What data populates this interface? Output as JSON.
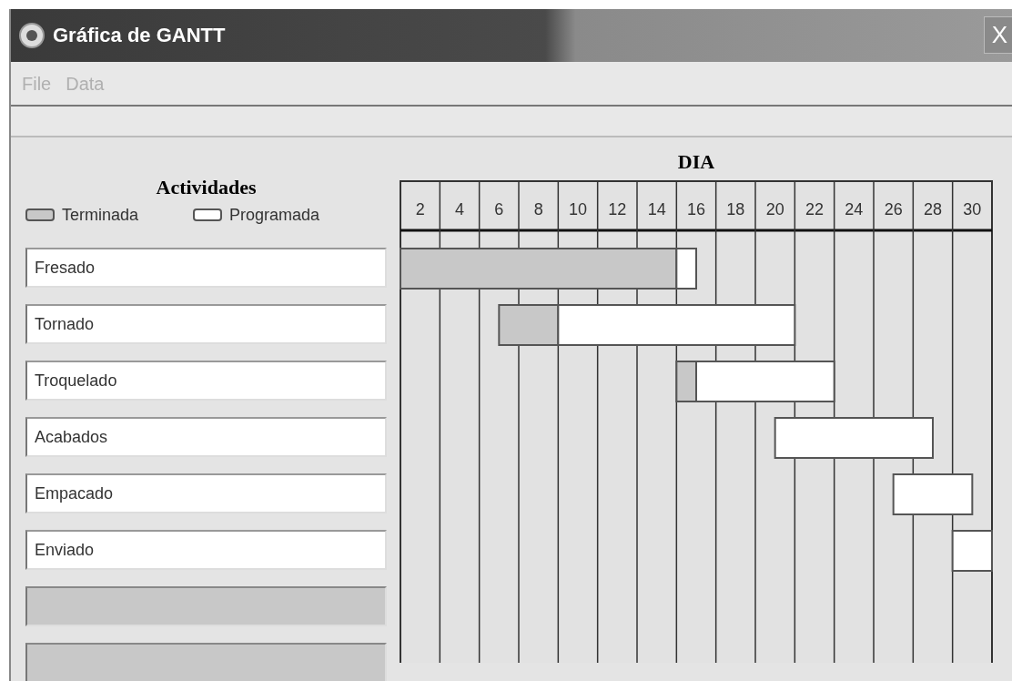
{
  "window": {
    "title": "Gráfica de GANTT",
    "close": "X"
  },
  "menu": [
    {
      "label": "File",
      "disabled": true
    },
    {
      "label": "Data",
      "disabled": true
    }
  ],
  "activities_panel": {
    "title": "Actividades"
  },
  "legend": [
    {
      "kind": "done",
      "label": "Terminada"
    },
    {
      "kind": "plan",
      "label": "Programada"
    }
  ],
  "timeline": {
    "title": "DIA",
    "days": [
      "2",
      "4",
      "6",
      "8",
      "10",
      "12",
      "14",
      "16",
      "18",
      "20",
      "22",
      "24",
      "26",
      "28",
      "30"
    ]
  },
  "activities": [
    {
      "kind": "named",
      "name": "Fresado",
      "day_slots": [
        {
          "kind": "done"
        },
        {
          "kind": "done"
        },
        {
          "kind": "done"
        },
        {
          "kind": "done"
        },
        {
          "kind": "done"
        },
        {
          "kind": "done"
        },
        {
          "kind": "done"
        },
        {
          "kind": "done"
        },
        {
          "kind": "done"
        },
        {
          "kind": "done"
        },
        {
          "kind": "done"
        },
        {
          "kind": "done"
        },
        {
          "kind": "done"
        },
        {
          "kind": "done"
        },
        {
          "kind": "plan"
        }
      ]
    },
    {
      "kind": "named",
      "name": "Tornado",
      "day_slots": [
        {
          "kind": "none"
        },
        {
          "kind": "none"
        },
        {
          "kind": "none"
        },
        {
          "kind": "none"
        },
        {
          "kind": "none"
        },
        {
          "kind": "done"
        },
        {
          "kind": "done"
        },
        {
          "kind": "done"
        },
        {
          "kind": "plan"
        },
        {
          "kind": "plan"
        },
        {
          "kind": "plan"
        },
        {
          "kind": "plan"
        },
        {
          "kind": "plan"
        },
        {
          "kind": "plan"
        },
        {
          "kind": "plan"
        },
        {
          "kind": "plan"
        },
        {
          "kind": "plan"
        },
        {
          "kind": "plan"
        },
        {
          "kind": "plan"
        },
        {
          "kind": "plan"
        }
      ]
    },
    {
      "kind": "named",
      "name": "Troquelado",
      "day_slots": [
        {
          "kind": "none"
        },
        {
          "kind": "none"
        },
        {
          "kind": "none"
        },
        {
          "kind": "none"
        },
        {
          "kind": "none"
        },
        {
          "kind": "none"
        },
        {
          "kind": "none"
        },
        {
          "kind": "none"
        },
        {
          "kind": "none"
        },
        {
          "kind": "none"
        },
        {
          "kind": "none"
        },
        {
          "kind": "none"
        },
        {
          "kind": "none"
        },
        {
          "kind": "none"
        },
        {
          "kind": "done"
        },
        {
          "kind": "plan"
        },
        {
          "kind": "plan"
        },
        {
          "kind": "plan"
        },
        {
          "kind": "plan"
        },
        {
          "kind": "plan"
        },
        {
          "kind": "plan"
        },
        {
          "kind": "plan"
        }
      ]
    },
    {
      "kind": "named",
      "name": "Acabados",
      "day_slots": [
        {
          "kind": "none"
        },
        {
          "kind": "none"
        },
        {
          "kind": "none"
        },
        {
          "kind": "none"
        },
        {
          "kind": "none"
        },
        {
          "kind": "none"
        },
        {
          "kind": "none"
        },
        {
          "kind": "none"
        },
        {
          "kind": "none"
        },
        {
          "kind": "none"
        },
        {
          "kind": "none"
        },
        {
          "kind": "none"
        },
        {
          "kind": "none"
        },
        {
          "kind": "none"
        },
        {
          "kind": "none"
        },
        {
          "kind": "none"
        },
        {
          "kind": "none"
        },
        {
          "kind": "none"
        },
        {
          "kind": "none"
        },
        {
          "kind": "plan"
        },
        {
          "kind": "plan"
        },
        {
          "kind": "plan"
        },
        {
          "kind": "plan"
        },
        {
          "kind": "plan"
        },
        {
          "kind": "plan"
        },
        {
          "kind": "plan"
        },
        {
          "kind": "plan"
        }
      ]
    },
    {
      "kind": "named",
      "name": "Empacado",
      "day_slots": [
        {
          "kind": "none"
        },
        {
          "kind": "none"
        },
        {
          "kind": "none"
        },
        {
          "kind": "none"
        },
        {
          "kind": "none"
        },
        {
          "kind": "none"
        },
        {
          "kind": "none"
        },
        {
          "kind": "none"
        },
        {
          "kind": "none"
        },
        {
          "kind": "none"
        },
        {
          "kind": "none"
        },
        {
          "kind": "none"
        },
        {
          "kind": "none"
        },
        {
          "kind": "none"
        },
        {
          "kind": "none"
        },
        {
          "kind": "none"
        },
        {
          "kind": "none"
        },
        {
          "kind": "none"
        },
        {
          "kind": "none"
        },
        {
          "kind": "none"
        },
        {
          "kind": "none"
        },
        {
          "kind": "none"
        },
        {
          "kind": "none"
        },
        {
          "kind": "none"
        },
        {
          "kind": "none"
        },
        {
          "kind": "plan"
        },
        {
          "kind": "plan"
        },
        {
          "kind": "plan"
        },
        {
          "kind": "plan"
        }
      ]
    },
    {
      "kind": "named",
      "name": "Enviado",
      "day_slots": [
        {
          "kind": "none"
        },
        {
          "kind": "none"
        },
        {
          "kind": "none"
        },
        {
          "kind": "none"
        },
        {
          "kind": "none"
        },
        {
          "kind": "none"
        },
        {
          "kind": "none"
        },
        {
          "kind": "none"
        },
        {
          "kind": "none"
        },
        {
          "kind": "none"
        },
        {
          "kind": "none"
        },
        {
          "kind": "none"
        },
        {
          "kind": "none"
        },
        {
          "kind": "none"
        },
        {
          "kind": "none"
        },
        {
          "kind": "none"
        },
        {
          "kind": "none"
        },
        {
          "kind": "none"
        },
        {
          "kind": "none"
        },
        {
          "kind": "none"
        },
        {
          "kind": "none"
        },
        {
          "kind": "none"
        },
        {
          "kind": "none"
        },
        {
          "kind": "none"
        },
        {
          "kind": "none"
        },
        {
          "kind": "none"
        },
        {
          "kind": "none"
        },
        {
          "kind": "none"
        },
        {
          "kind": "plan"
        },
        {
          "kind": "plan"
        }
      ]
    },
    {
      "kind": "blank"
    },
    {
      "kind": "blank"
    }
  ]
}
